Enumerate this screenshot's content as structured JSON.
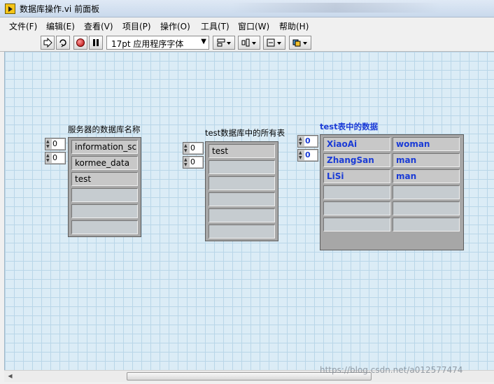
{
  "window": {
    "title": "数据库操作.vi 前面板"
  },
  "menu": [
    "文件(F)",
    "编辑(E)",
    "查看(V)",
    "项目(P)",
    "操作(O)",
    "工具(T)",
    "窗口(W)",
    "帮助(H)"
  ],
  "toolbar": {
    "font_label": "17pt 应用程序字体",
    "icons": [
      "run-arrow-icon",
      "run-continuously-icon",
      "abort-stop-icon",
      "pause-icon",
      "align-objects-icon",
      "distribute-objects-icon",
      "resize-objects-icon",
      "reorder-icon"
    ]
  },
  "controls": {
    "db_names": {
      "label": "服务器的数据库名称",
      "index": [
        "0",
        "0"
      ],
      "cells": [
        "information_sc",
        "kormee_data",
        "test",
        "",
        "",
        ""
      ]
    },
    "table_names": {
      "label": "test数据库中的所有表",
      "index": [
        "0",
        "0"
      ],
      "cells": [
        "test",
        "",
        "",
        "",
        "",
        ""
      ]
    },
    "table_data": {
      "label": "test表中的数据",
      "index": [
        "0",
        "0"
      ],
      "rows": [
        [
          "XiaoAi",
          "woman"
        ],
        [
          "ZhangSan",
          "man"
        ],
        [
          "LiSi",
          "man"
        ],
        [
          "",
          ""
        ],
        [
          "",
          ""
        ],
        [
          "",
          ""
        ]
      ]
    }
  },
  "watermark": "https://blog.csdn.net/a012577474",
  "colors": {
    "panel_bg": "#dbecf6",
    "grid": "#b9d6e8",
    "indicator_text": "#1a3bd6"
  }
}
